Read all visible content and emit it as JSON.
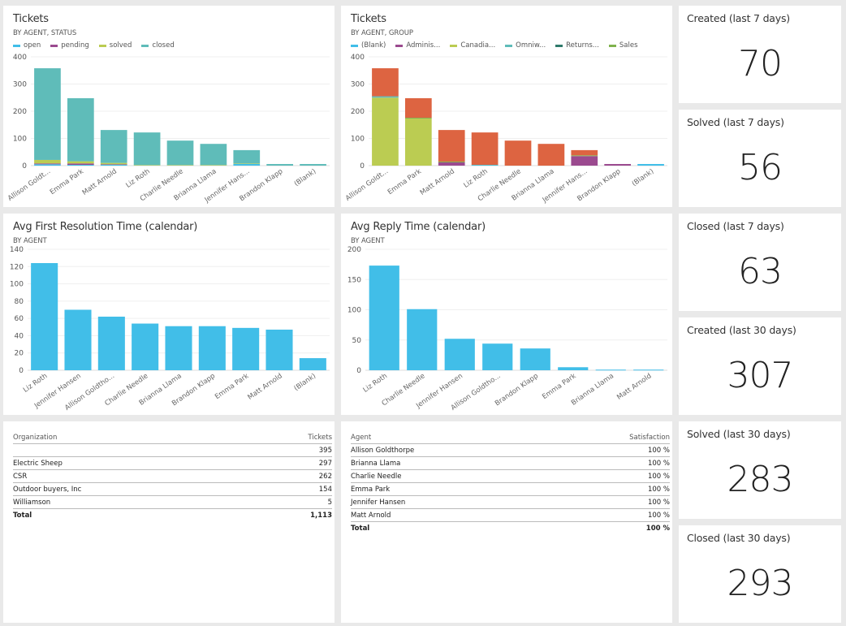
{
  "colors": {
    "open": "#41bee8",
    "pending": "#9b4a8f",
    "solved": "#bbcc52",
    "closed": "#5fbcb9",
    "blank": "#41bee8",
    "adminis": "#9b4a8f",
    "canadia": "#bbcc52",
    "omniw": "#5fbcb9",
    "returns": "#2f7a6b",
    "sales": "#7fb24d",
    "other_group": "#dd6441",
    "single": "#41bee8"
  },
  "chart_data": [
    {
      "id": "tickets_status",
      "type": "bar",
      "stacked": true,
      "title": "Tickets",
      "subtitle": "BY AGENT, STATUS",
      "xlabel": "",
      "ylabel": "",
      "ylim": [
        0,
        400
      ],
      "yticks": [
        0,
        100,
        200,
        300,
        400
      ],
      "grid": true,
      "legend": "top-left",
      "categories": [
        "Allison Goldt...",
        "Emma Park",
        "Matt Arnold",
        "Liz Roth",
        "Charlie Needle",
        "Brianna Llama",
        "Jennifer Hans...",
        "Brandon Klapp",
        "(Blank)"
      ],
      "series": [
        {
          "name": "open",
          "color_key": "open",
          "values": [
            5,
            3,
            3,
            0,
            0,
            0,
            7,
            0,
            0
          ]
        },
        {
          "name": "pending",
          "color_key": "pending",
          "values": [
            3,
            5,
            2,
            0,
            0,
            0,
            0,
            0,
            0
          ]
        },
        {
          "name": "solved",
          "color_key": "solved",
          "values": [
            13,
            8,
            5,
            2,
            2,
            2,
            2,
            0,
            0
          ]
        },
        {
          "name": "closed",
          "color_key": "closed",
          "values": [
            337,
            232,
            121,
            120,
            90,
            78,
            48,
            6,
            6
          ]
        }
      ]
    },
    {
      "id": "tickets_group",
      "type": "bar",
      "stacked": true,
      "title": "Tickets",
      "subtitle": "BY AGENT, GROUP",
      "xlabel": "",
      "ylabel": "",
      "ylim": [
        0,
        400
      ],
      "yticks": [
        0,
        100,
        200,
        300,
        400
      ],
      "grid": true,
      "legend": "top-left",
      "categories": [
        "Allison Goldt...",
        "Emma Park",
        "Matt Arnold",
        "Liz Roth",
        "Charlie Needle",
        "Brianna Llama",
        "Jennifer Hans...",
        "Brandon Klapp",
        "(Blank)"
      ],
      "series": [
        {
          "name": "(Blank)",
          "color_key": "blank",
          "values": [
            0,
            0,
            0,
            2,
            0,
            0,
            0,
            0,
            6
          ]
        },
        {
          "name": "Adminis...",
          "color_key": "adminis",
          "values": [
            0,
            0,
            12,
            0,
            0,
            0,
            35,
            6,
            0
          ]
        },
        {
          "name": "Canadia...",
          "color_key": "canadia",
          "values": [
            250,
            173,
            0,
            0,
            0,
            0,
            0,
            0,
            0
          ]
        },
        {
          "name": "Omniw...",
          "color_key": "omniw",
          "values": [
            5,
            0,
            0,
            1,
            0,
            0,
            0,
            0,
            0
          ]
        },
        {
          "name": "Returns...",
          "color_key": "returns",
          "values": [
            0,
            0,
            0,
            0,
            0,
            0,
            0,
            0,
            0
          ]
        },
        {
          "name": "Sales",
          "color_key": "sales",
          "values": [
            0,
            3,
            3,
            0,
            0,
            0,
            3,
            0,
            0
          ]
        },
        {
          "name": "",
          "color_key": "other_group",
          "in_legend": false,
          "values": [
            103,
            72,
            116,
            119,
            92,
            80,
            19,
            0,
            0
          ]
        }
      ]
    },
    {
      "id": "first_resolution",
      "type": "bar",
      "title": "Avg First Resolution Time (calendar)",
      "subtitle": "BY AGENT",
      "xlabel": "",
      "ylabel": "",
      "ylim": [
        0,
        140
      ],
      "yticks": [
        0,
        20,
        40,
        60,
        80,
        100,
        120,
        140
      ],
      "grid": true,
      "categories": [
        "Liz Roth",
        "Jennifer Hansen",
        "Allison Goldtho...",
        "Charlie Needle",
        "Brianna Llama",
        "Brandon Klapp",
        "Emma Park",
        "Matt Arnold",
        "(Blank)"
      ],
      "values": [
        124,
        70,
        62,
        54,
        51,
        51,
        49,
        47,
        14
      ]
    },
    {
      "id": "reply_time",
      "type": "bar",
      "title": "Avg Reply Time (calendar)",
      "subtitle": "BY AGENT",
      "xlabel": "",
      "ylabel": "",
      "ylim": [
        0,
        200
      ],
      "yticks": [
        0,
        50,
        100,
        150,
        200
      ],
      "grid": true,
      "categories": [
        "Liz Roth",
        "Charlie Needle",
        "Jennifer Hansen",
        "Allison Goldtho...",
        "Brandon Klapp",
        "Emma Park",
        "Brianna Llama",
        "Matt Arnold"
      ],
      "values": [
        173,
        101,
        52,
        44,
        36,
        5,
        1,
        1
      ]
    }
  ],
  "cards": [
    {
      "title": "Created (last 7 days)",
      "value": "70"
    },
    {
      "title": "Solved (last 7 days)",
      "value": "56"
    },
    {
      "title": "Closed (last 7 days)",
      "value": "63"
    },
    {
      "title": "Created (last 30 days)",
      "value": "307"
    },
    {
      "title": "Solved (last 30 days)",
      "value": "283"
    },
    {
      "title": "Closed (last 30 days)",
      "value": "293"
    }
  ],
  "org_table": {
    "headers": [
      "Organization",
      "Tickets"
    ],
    "rows": [
      [
        "",
        "395"
      ],
      [
        "Electric Sheep",
        "297"
      ],
      [
        "CSR",
        "262"
      ],
      [
        "Outdoor buyers, Inc",
        "154"
      ],
      [
        "Williamson",
        "5"
      ]
    ],
    "total": [
      "Total",
      "1,113"
    ]
  },
  "agent_table": {
    "headers": [
      "Agent",
      "Satisfaction"
    ],
    "rows": [
      [
        "Allison Goldthorpe",
        "100 %"
      ],
      [
        "Brianna Llama",
        "100 %"
      ],
      [
        "Charlie Needle",
        "100 %"
      ],
      [
        "Emma Park",
        "100 %"
      ],
      [
        "Jennifer Hansen",
        "100 %"
      ],
      [
        "Matt Arnold",
        "100 %"
      ]
    ],
    "total": [
      "Total",
      "100 %"
    ]
  }
}
